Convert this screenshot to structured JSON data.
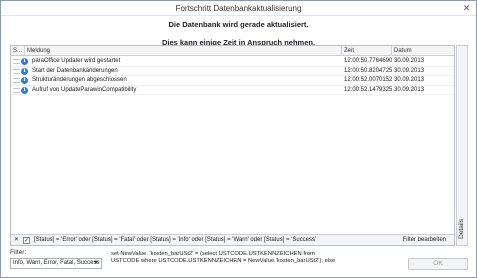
{
  "window": {
    "title": "Fortschritt Datenbankaktualisierung",
    "close_glyph": "✕"
  },
  "messages": {
    "line1": "Die Datenbank wird gerade aktualisiert.",
    "line2": "Dies kann einige Zeit in Anspruch nehmen."
  },
  "grid": {
    "columns": {
      "status": "S...",
      "meldung": "Meldung",
      "zeit": "Zeit",
      "datum": "Datum"
    },
    "rows": [
      {
        "meldung": "paraOffice Updater wird gestartet",
        "zeit": "12:00:50.7764690",
        "datum": "30.09.2013"
      },
      {
        "meldung": "Start der Datenbankänderungen",
        "zeit": "12:00:50.8204725",
        "datum": "30.09.2013"
      },
      {
        "meldung": "Strukturänderungen abgeschlossen",
        "zeit": "12:00:52.0070152",
        "datum": "30.09.2013"
      },
      {
        "meldung": "Aufruf von UpdateParawinCompatibility",
        "zeit": "12:00:52.1479325",
        "datum": "30.09.2013"
      }
    ],
    "info_glyph": "i",
    "filter": {
      "close_glyph": "✕",
      "check_glyph": "✓",
      "expression": "[Status] = 'Error' oder [Status] = 'Fatal' oder [Status] = 'Info' oder [Status] = 'Warn' oder [Status] = 'Success'",
      "edit_label": "Filter bearbeiten"
    }
  },
  "side_panel": {
    "label": "Details"
  },
  "bottom": {
    "filter_label": "Filter:",
    "filter_value": "Info, Warn, Error, Fatal, Success",
    "status_text": "set NewValue. 'kosten_barUSt2' = (select USTCODE.USTKENNZEICHEN from USTCODE where USTCODE.USTKENNZEICHEN = NewValue.'kosten_barUSt2'); else",
    "ok_label": "OK"
  }
}
